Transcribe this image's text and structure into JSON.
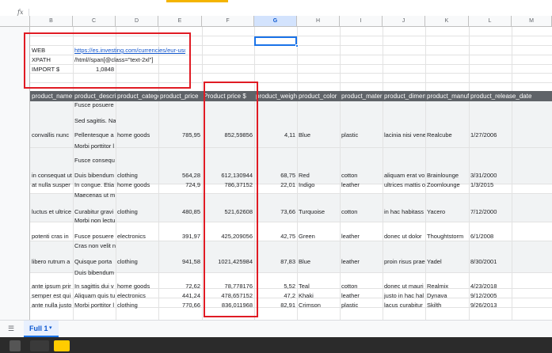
{
  "formula_bar": {
    "fx_label": "fx"
  },
  "columns": [
    "B",
    "C",
    "D",
    "E",
    "F",
    "G",
    "H",
    "I",
    "J",
    "K",
    "L",
    "M"
  ],
  "selected_column": "G",
  "params": {
    "web_label": "WEB",
    "web_value": "https://es.investing.com/currencies/eur-usd",
    "xpath_label": "XPATH",
    "xpath_value": "/html//span[@class=\"text-2xl\"]",
    "import_label": "IMPORT $",
    "import_value": "1,0848"
  },
  "headers": [
    "product_name",
    "product_descri",
    "product_catego",
    "product_price",
    "Product price $",
    "product_weigh",
    "product_color",
    "product_materi",
    "product_dimen",
    "product_manuf",
    "product_release_date"
  ],
  "header_color": "#5f6368",
  "wrapped_desc": {
    "r1": [
      "Fusce posuere",
      "Sed sagittis. Na"
    ],
    "r2": [
      "Morbi porttitor l",
      "Fusce consequ"
    ],
    "r5": [
      "Maecenas ut m"
    ],
    "r6": [
      "Morbi non lectu"
    ],
    "r7": [
      "Cras non velit n"
    ],
    "r8": [
      "Duis bibendum"
    ]
  },
  "rows": {
    "r1": [
      "convallis nunc",
      "Pellentesque a",
      "home goods",
      "785,95",
      "852,59856",
      "4,11",
      "Blue",
      "plastic",
      "lacinia nisi vene",
      "Realcube",
      "1/27/2006"
    ],
    "r2": [
      "in consequat ut",
      "Duis bibendum",
      "clothing",
      "564,28",
      "612,130944",
      "68,75",
      "Red",
      "cotton",
      "aliquam erat vo",
      "Brainlounge",
      "3/31/2000"
    ],
    "r3": [
      "at nulla susper",
      "In congue. Etia",
      "home goods",
      "724,9",
      "786,37152",
      "22,01",
      "Indigo",
      "leather",
      "ultrices mattis o",
      "Zoomlounge",
      "1/3/2015"
    ],
    "r4": [
      "luctus et ultrice",
      "Curabitur gravi",
      "clothing",
      "480,85",
      "521,62608",
      "73,66",
      "Turquoise",
      "cotton",
      "in hac habitass",
      "Yacero",
      "7/12/2000"
    ],
    "r5": [
      "potenti cras in",
      "Fusce posuere",
      "electronics",
      "391,97",
      "425,209056",
      "42,75",
      "Green",
      "leather",
      "donec ut dolor",
      "Thoughtstorm",
      "6/1/2008"
    ],
    "r6": [
      "libero rutrum a",
      "Quisque porta",
      "clothing",
      "941,58",
      "1021,425984",
      "87,83",
      "Blue",
      "leather",
      "proin risus prae",
      "Yadel",
      "8/30/2001"
    ],
    "r7": [
      "ante ipsum prir",
      "In sagittis dui v",
      "home goods",
      "72,62",
      "78,778176",
      "5,52",
      "Teal",
      "cotton",
      "donec ut mauri",
      "Realmix",
      "4/23/2018"
    ],
    "r8": [
      "semper est qui",
      "Aliquam quis tu",
      "electronics",
      "441,24",
      "478,657152",
      "47,2",
      "Khaki",
      "leather",
      "justo in hac hal",
      "Dynava",
      "9/12/2005"
    ],
    "r9": [
      "ante nulla justo",
      "Morbi porttitor l",
      "clothing",
      "770,66",
      "836,011968",
      "82,91",
      "Crimson",
      "plastic",
      "lacus curabitur",
      "Skilth",
      "9/26/2013"
    ]
  },
  "sheet_tab": {
    "label": "Full 1",
    "caret": "▾",
    "menu_glyph": "☰"
  },
  "colors": {
    "selection": "#1a73e8",
    "annotation": "#e01b24",
    "header_bg": "#5f6368",
    "link": "#1155cc"
  },
  "icons": [
    "sheets-list-icon",
    "tab-dropdown-icon"
  ]
}
